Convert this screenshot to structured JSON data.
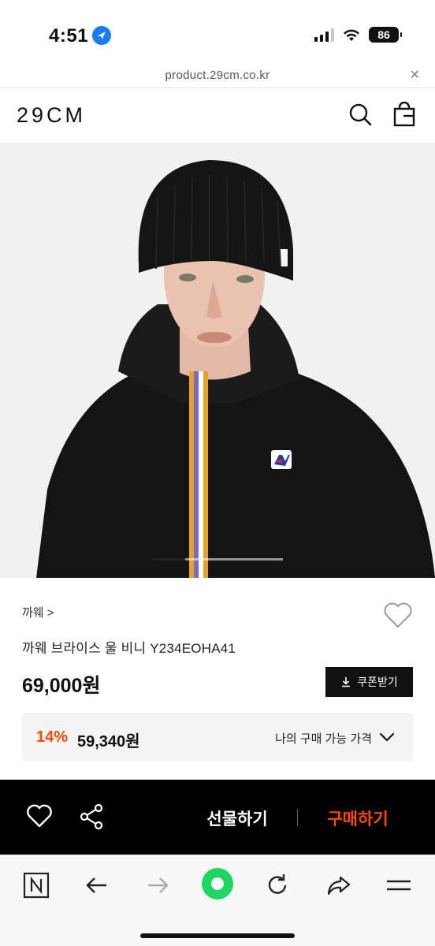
{
  "status": {
    "time": "4:51",
    "battery": "86"
  },
  "browser": {
    "url": "product.29cm.co.kr",
    "close_label": "×"
  },
  "header": {
    "logo": "29CM"
  },
  "carousel": {
    "current_fraction": 0.25
  },
  "product": {
    "brand": "까웨 >",
    "name": "까웨 브라이스 울 비니 Y234EOHA41",
    "price": "69,000원",
    "coupon_label": "쿠폰받기",
    "discount_rate": "14%",
    "discount_price": "59,340원",
    "my_price_label": "나의 구매 가능 가격"
  },
  "actions": {
    "gift_label": "선물하기",
    "buy_label": "구매하기"
  },
  "colors": {
    "accent": "#ff4800",
    "black": "#000000",
    "browser_green": "#1ed760"
  }
}
